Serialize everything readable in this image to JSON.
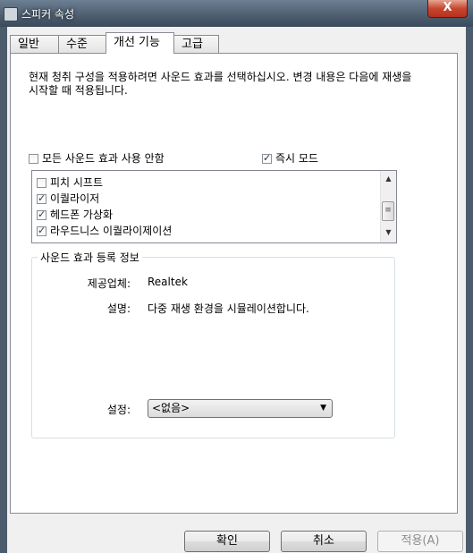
{
  "window": {
    "title": "스피커 속성",
    "close_label": "X"
  },
  "tabs": [
    {
      "label": "일반",
      "active": false
    },
    {
      "label": "수준",
      "active": false
    },
    {
      "label": "개선 기능",
      "active": true
    },
    {
      "label": "고급",
      "active": false
    }
  ],
  "description": "현재 청취 구성을 적용하려면 사운드 효과를 선택하십시오. 변경 내용은 다음에 재생을 시작할 때 적용됩니다.",
  "disable_all": {
    "label": "모든 사운드 효과 사용 안함",
    "checked": false
  },
  "immediate_mode": {
    "label": "즉시 모드",
    "checked": true
  },
  "effects": [
    {
      "label": "피치 시프트",
      "checked": false
    },
    {
      "label": "이퀄라이저",
      "checked": true
    },
    {
      "label": "헤드폰 가상화",
      "checked": true
    },
    {
      "label": "라우드니스 이퀄라이제이션",
      "checked": true
    }
  ],
  "properties": {
    "legend": "사운드 효과 등록 정보",
    "provider_label": "제공업체:",
    "provider_value": "Realtek",
    "description_label": "설명:",
    "description_value": "다중 재생 환경을 시뮬레이션합니다.",
    "setting_label": "설정:",
    "setting_value": "<없음>"
  },
  "buttons": {
    "ok": "확인",
    "cancel": "취소",
    "apply": "적용(A)"
  }
}
